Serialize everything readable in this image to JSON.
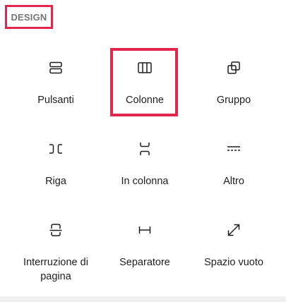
{
  "section": {
    "title": "DESIGN"
  },
  "blocks": [
    {
      "label": "Pulsanti",
      "icon": "buttons-icon"
    },
    {
      "label": "Colonne",
      "icon": "columns-icon",
      "highlighted": true
    },
    {
      "label": "Gruppo",
      "icon": "group-icon"
    },
    {
      "label": "Riga",
      "icon": "row-icon"
    },
    {
      "label": "In colonna",
      "icon": "stack-icon"
    },
    {
      "label": "Altro",
      "icon": "more-icon"
    },
    {
      "label": "Interruzione di pagina",
      "icon": "page-break-icon"
    },
    {
      "label": "Separatore",
      "icon": "separator-icon"
    },
    {
      "label": "Spazio vuoto",
      "icon": "spacer-icon"
    }
  ],
  "colors": {
    "highlight": "#e2264d",
    "text": "#1e1e1e",
    "muted": "#757575"
  }
}
